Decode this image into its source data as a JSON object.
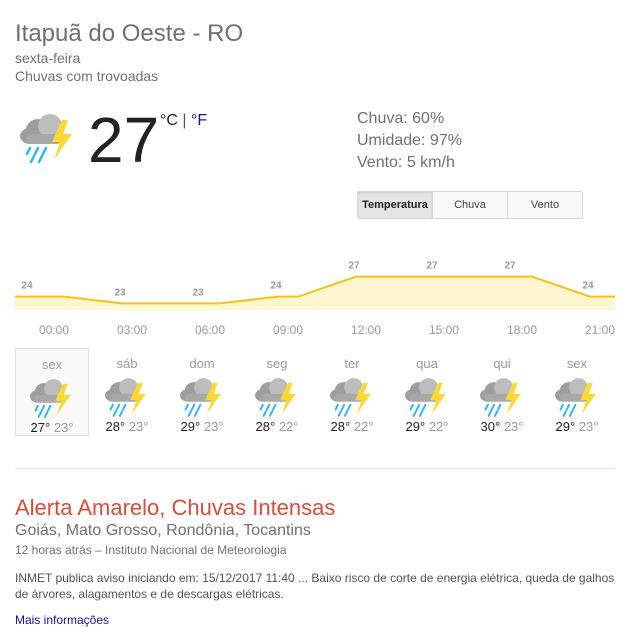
{
  "location": "Itapuã do Oeste - RO",
  "day": "sexta-feira",
  "condition": "Chuvas com trovoadas",
  "current": {
    "temp": "27",
    "unit_c": "°C",
    "separator": "|",
    "unit_f": "°F",
    "icon": "thunderstorm-rain-icon"
  },
  "stats": {
    "rain": "Chuva: 60%",
    "humidity": "Umidade: 97%",
    "wind": "Vento: 5 km/h"
  },
  "tabs": [
    "Temperatura",
    "Chuva",
    "Vento"
  ],
  "colors": {
    "line": "#f4c318",
    "fill": "#fff6cf",
    "alert": "#dd4b39",
    "link": "#1a0dab"
  },
  "chart_data": {
    "type": "area",
    "series": [
      {
        "values": [
          24,
          23,
          23,
          24,
          27,
          27,
          27,
          24
        ]
      }
    ],
    "x": [
      "00:00",
      "03:00",
      "06:00",
      "09:00",
      "12:00",
      "15:00",
      "18:00",
      "21:00"
    ],
    "labels": [
      "24",
      "23",
      "23",
      "24",
      "27",
      "27",
      "27",
      "24"
    ]
  },
  "forecast": [
    {
      "day": "sex",
      "hi": "27°",
      "lo": "23°"
    },
    {
      "day": "sáb",
      "hi": "28°",
      "lo": "23°"
    },
    {
      "day": "dom",
      "hi": "29°",
      "lo": "23°"
    },
    {
      "day": "seg",
      "hi": "28°",
      "lo": "22°"
    },
    {
      "day": "ter",
      "hi": "28°",
      "lo": "22°"
    },
    {
      "day": "qua",
      "hi": "29°",
      "lo": "22°"
    },
    {
      "day": "qui",
      "hi": "30°",
      "lo": "23°"
    },
    {
      "day": "sex",
      "hi": "29°",
      "lo": "23°"
    }
  ],
  "alert": {
    "title": "Alerta Amarelo, Chuvas Intensas",
    "regions": "Goiás, Mato Grosso, Rondônia, Tocantins",
    "meta": "12 horas atrás – Instituto Nacional de Meteorologia",
    "body": "INMET publica aviso iniciando em: 15/12/2017 11:40 ... Baixo risco de corte de energia elétrica, queda de galhos de árvores, alagamentos e de descargas elétricas.",
    "more": "Mais informações"
  }
}
